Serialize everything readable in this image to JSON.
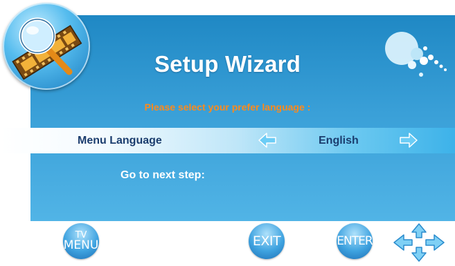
{
  "wizard": {
    "title": "Setup Wizard",
    "prompt": "Please select your prefer language :",
    "language_row": {
      "label": "Menu Language",
      "value": "English",
      "left_icon": "arrow-left-icon",
      "right_icon": "arrow-right-icon"
    },
    "next_step_label": "Go to next step:"
  },
  "footer": {
    "menu_button": {
      "top": "TV",
      "bottom": "MENU"
    },
    "exit_button": "EXIT",
    "enter_button": "ENTER",
    "navigation_icon": "four-way-arrows-icon"
  },
  "decor": {
    "logo_icon": "magnifier-film-icon",
    "bubbles_icon": "bubbles-icon"
  },
  "colors": {
    "panel": "#3aa0d8",
    "prompt": "#ff8a1a",
    "label_text": "#1b3d6e",
    "arrow": "#6ccdf6"
  }
}
